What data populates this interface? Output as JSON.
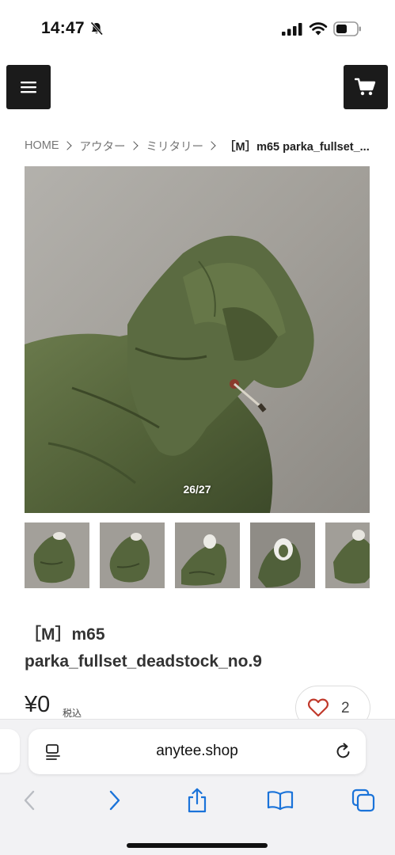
{
  "status_bar": {
    "time": "14:47",
    "icons": [
      "bell-slash-icon",
      "signal-icon",
      "wifi-icon",
      "battery-icon"
    ]
  },
  "header": {
    "menu_icon": "hamburger-icon",
    "cart_icon": "cart-icon"
  },
  "breadcrumb": {
    "items": [
      "HOME",
      "アウター",
      "ミリタリー"
    ],
    "current": "［M］m65 parka_fullset_..."
  },
  "gallery": {
    "counter": "26/27",
    "current_index": 26,
    "total": 27,
    "thumbnail_count": 5
  },
  "product": {
    "title_line1": "［M］m65",
    "title_line2": "parka_fullset_deadstock_no.9",
    "price": "¥0",
    "tax_label": "税込",
    "favorite_count": "2"
  },
  "browser": {
    "url": "anytee.shop",
    "toolbar": [
      "back-icon",
      "forward-icon",
      "share-icon",
      "bookmarks-icon",
      "tabs-icon"
    ]
  },
  "colors": {
    "header_button_bg": "#1b1b1b",
    "heart": "#c0392b",
    "toolbar_active": "#1a73d9",
    "toolbar_disabled": "#b9bcc2",
    "jacket_green": "#56663d"
  }
}
